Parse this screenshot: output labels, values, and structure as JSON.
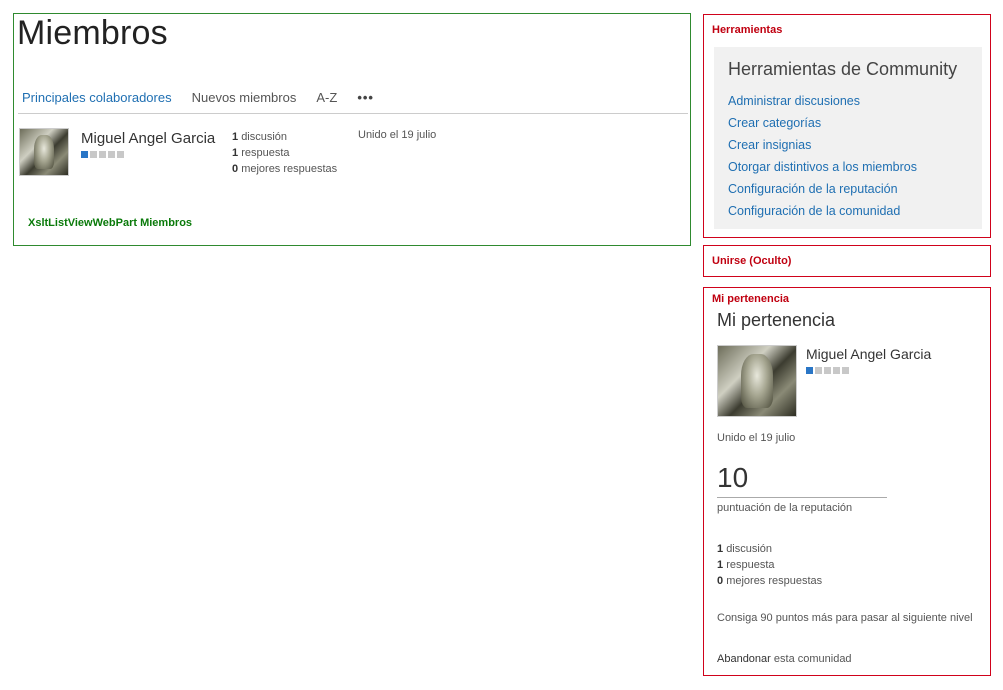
{
  "main": {
    "title": "Miembros",
    "tabs": [
      {
        "label": "Principales colaboradores"
      },
      {
        "label": "Nuevos miembros"
      },
      {
        "label": "A-Z"
      }
    ],
    "more_label": "•••",
    "member": {
      "name": "Miguel Angel Garcia",
      "level_filled": 1,
      "level_total": 5,
      "discussions_count": "1",
      "discussions_label": "discusión",
      "replies_count": "1",
      "replies_label": "respuesta",
      "best_count": "0",
      "best_label": "mejores respuestas",
      "joined": "Unido el 19 julio"
    },
    "webpart_label": "XsltListViewWebPart Miembros"
  },
  "tools": {
    "zone_title": "Herramientas",
    "heading": "Herramientas de Community",
    "links": [
      {
        "label": "Administrar discusiones"
      },
      {
        "label": "Crear categorías"
      },
      {
        "label": "Crear insignias"
      },
      {
        "label": "Otorgar distintivos a los miembros"
      },
      {
        "label": "Configuración de la reputación"
      },
      {
        "label": "Configuración de la comunidad"
      }
    ]
  },
  "join": {
    "zone_title": "Unirse (Oculto)"
  },
  "membership": {
    "zone_title": "Mi pertenencia",
    "heading": "Mi pertenencia",
    "name": "Miguel Angel Garcia",
    "level_filled": 1,
    "level_total": 5,
    "joined": "Unido el 19 julio",
    "score": "10",
    "score_label": "puntuación de la reputación",
    "discussions_count": "1",
    "discussions_label": "discusión",
    "replies_count": "1",
    "replies_label": "respuesta",
    "best_count": "0",
    "best_label": "mejores respuestas",
    "next_level": "Consiga 90 puntos más para pasar al siguiente nivel",
    "leave_link": "Abandonar",
    "leave_rest": "esta comunidad"
  },
  "colors": {
    "link": "#1f6fb2",
    "zone_green": "#2f8a2f",
    "zone_red": "#d0021b",
    "level_on": "#2a76c6",
    "level_off": "#c8c8c8"
  }
}
